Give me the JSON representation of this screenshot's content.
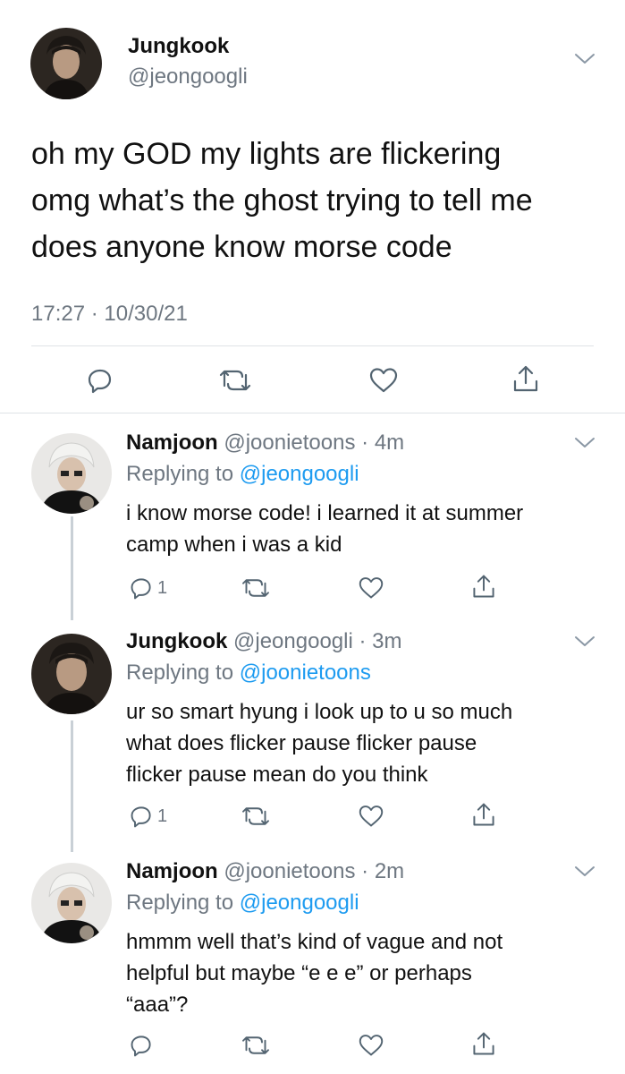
{
  "main_tweet": {
    "name": "Jungkook",
    "handle": "@jeongoogli",
    "text_lines": [
      "oh my GOD my lights are flickering",
      "omg what’s the ghost trying to tell me",
      "does anyone know morse code"
    ],
    "timestamp": "17:27 · 10/30/21",
    "actions": [
      "reply-icon",
      "retweet-icon",
      "like-icon",
      "share-icon"
    ]
  },
  "replies": [
    {
      "name": "Namjoon",
      "handle": "@joonietoons",
      "time": "· 4m",
      "replying_prefix": "Replying to ",
      "replying_to": "@jeongoogli",
      "text_lines": [
        "i know morse code! i learned it at summer",
        "camp when i was a kid"
      ],
      "reply_count": "1"
    },
    {
      "name": "Jungkook",
      "handle": "@jeongoogli",
      "time": "· 3m",
      "replying_prefix": "Replying to ",
      "replying_to": "@joonietoons",
      "text_lines": [
        "ur so smart hyung i look up to u so much",
        "what does flicker pause flicker pause",
        "flicker pause mean do you think"
      ],
      "reply_count": "1"
    },
    {
      "name": "Namjoon",
      "handle": "@joonietoons",
      "time": "· 2m",
      "replying_prefix": "Replying to ",
      "replying_to": "@jeongoogli",
      "text_lines": [
        "hmmm well that’s kind of vague and not",
        "helpful but maybe “e e e” or perhaps",
        "“aaa”?"
      ],
      "reply_count": ""
    }
  ],
  "colors": {
    "link": "#1d9bf0",
    "muted": "#6e7781",
    "divider": "#dfe3e6"
  }
}
